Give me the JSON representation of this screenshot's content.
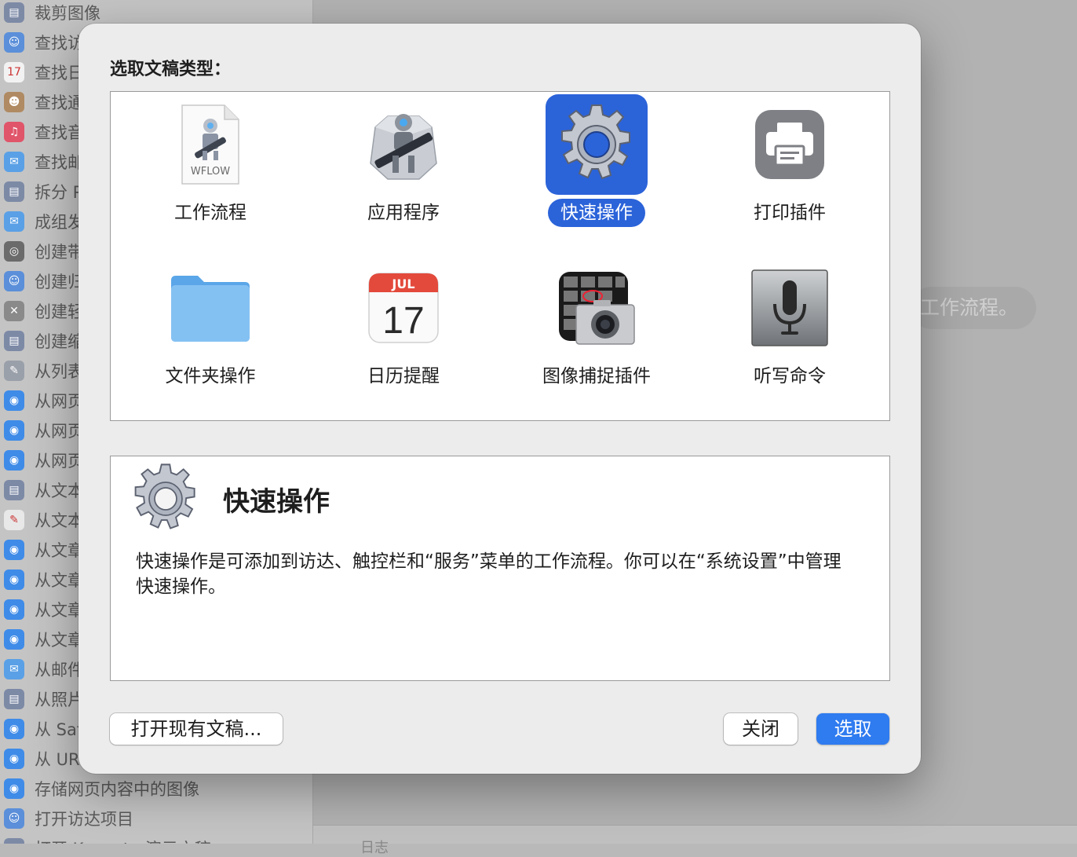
{
  "background": {
    "sidebar_items": [
      {
        "label": "裁剪图像",
        "color": "#7d8aa6",
        "glyph": "▤"
      },
      {
        "label": "查找访",
        "color": "#5b8fd9",
        "glyph": "☺"
      },
      {
        "label": "查找日",
        "color": "#f2f2f2",
        "glyph": "17"
      },
      {
        "label": "查找通",
        "color": "#b08a62",
        "glyph": "☻"
      },
      {
        "label": "查找音",
        "color": "#e0556a",
        "glyph": "♫"
      },
      {
        "label": "查找邮",
        "color": "#5aa0e6",
        "glyph": "✉"
      },
      {
        "label": "拆分 P",
        "color": "#7d8aa6",
        "glyph": "▤"
      },
      {
        "label": "成组发",
        "color": "#5aa0e6",
        "glyph": "✉"
      },
      {
        "label": "创建带",
        "color": "#6b6b6b",
        "glyph": "◎"
      },
      {
        "label": "创建归",
        "color": "#5b8fd9",
        "glyph": "☺"
      },
      {
        "label": "创建轻",
        "color": "#8a8a8a",
        "glyph": "✕"
      },
      {
        "label": "创建缩",
        "color": "#7d8aa6",
        "glyph": "▤"
      },
      {
        "label": "从列表",
        "color": "#9aa0aa",
        "glyph": "✎"
      },
      {
        "label": "从网页",
        "color": "#3f8be8",
        "glyph": "◉"
      },
      {
        "label": "从网页",
        "color": "#3f8be8",
        "glyph": "◉"
      },
      {
        "label": "从网页",
        "color": "#3f8be8",
        "glyph": "◉"
      },
      {
        "label": "从文本",
        "color": "#7d8aa6",
        "glyph": "▤"
      },
      {
        "label": "从文本",
        "color": "#e8e8e8",
        "glyph": "✎"
      },
      {
        "label": "从文章",
        "color": "#3f8be8",
        "glyph": "◉"
      },
      {
        "label": "从文章",
        "color": "#3f8be8",
        "glyph": "◉"
      },
      {
        "label": "从文章",
        "color": "#3f8be8",
        "glyph": "◉"
      },
      {
        "label": "从文章",
        "color": "#3f8be8",
        "glyph": "◉"
      },
      {
        "label": "从邮件",
        "color": "#5aa0e6",
        "glyph": "✉"
      },
      {
        "label": "从照片",
        "color": "#7d8aa6",
        "glyph": "▤"
      },
      {
        "label": "从 Saf",
        "color": "#3f8be8",
        "glyph": "◉"
      },
      {
        "label": "从 UR",
        "color": "#3f8be8",
        "glyph": "◉"
      },
      {
        "label": "存储网页内容中的图像",
        "color": "#3f8be8",
        "glyph": "◉"
      },
      {
        "label": "打开访达项目",
        "color": "#5b8fd9",
        "glyph": "☺"
      },
      {
        "label": "打开 Keynote 演示文稿",
        "color": "#7d8aa6",
        "glyph": "▤"
      }
    ],
    "hint_text": "工作流程。",
    "bottom_label": "日志"
  },
  "dialog": {
    "title": "选取文稿类型：",
    "types": [
      {
        "label": "工作流程",
        "icon": "workflow-file-icon",
        "selected": false
      },
      {
        "label": "应用程序",
        "icon": "automator-robot-icon",
        "selected": false
      },
      {
        "label": "快速操作",
        "icon": "gear-icon",
        "selected": true
      },
      {
        "label": "打印插件",
        "icon": "printer-icon",
        "selected": false
      },
      {
        "label": "文件夹操作",
        "icon": "folder-icon",
        "selected": false
      },
      {
        "label": "日历提醒",
        "icon": "calendar-icon",
        "selected": false,
        "month": "JUL",
        "day": "17"
      },
      {
        "label": "图像捕捉插件",
        "icon": "image-capture-icon",
        "selected": false
      },
      {
        "label": "听写命令",
        "icon": "microphone-icon",
        "selected": false
      }
    ],
    "workflow_badge": "WFLOW",
    "description": {
      "title": "快速操作",
      "text": "快速操作是可添加到访达、触控栏和“服务”菜单的工作流程。你可以在“系统设置”中管理快速操作。"
    },
    "buttons": {
      "open": "打开现有文稿...",
      "close": "关闭",
      "choose": "选取"
    },
    "colors": {
      "accent": "#2b63d9",
      "primary_button": "#2f7bf0"
    }
  }
}
